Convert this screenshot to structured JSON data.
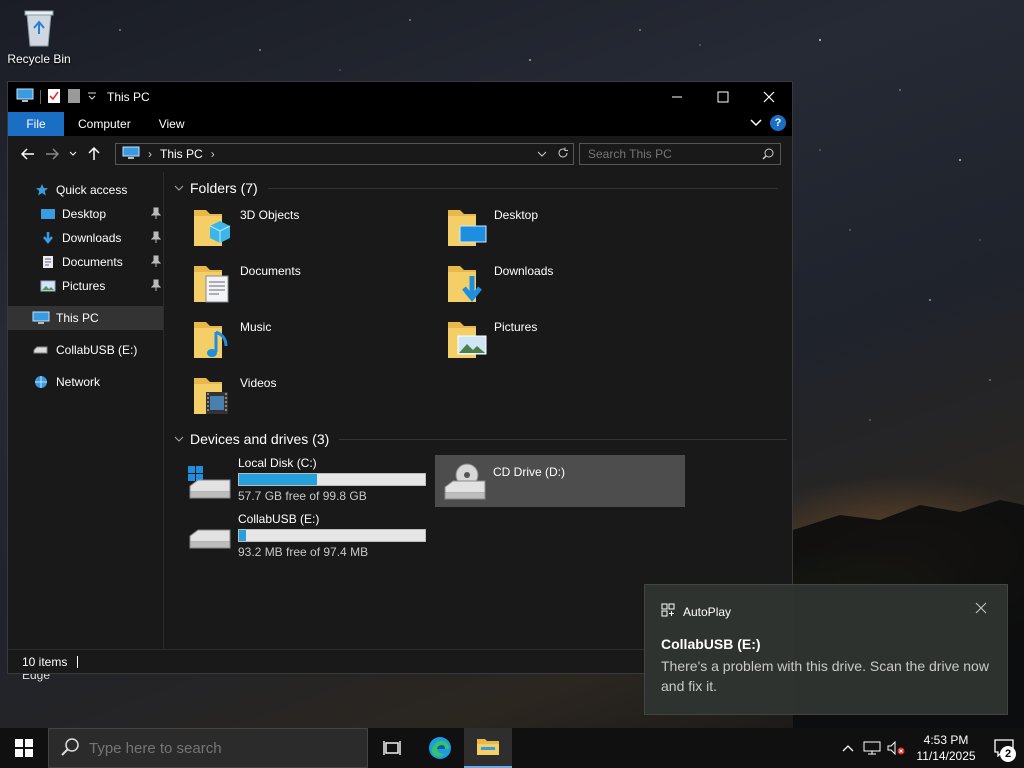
{
  "desktop": {
    "recycle_bin_label": "Recycle Bin",
    "edge_label": "Edge"
  },
  "window": {
    "title": "This PC",
    "ribbon_tabs": [
      "File",
      "Computer",
      "View"
    ],
    "help_label": "?",
    "address": {
      "crumb": "This PC"
    },
    "search_placeholder": "Search This PC",
    "status": {
      "item_count": "10 items"
    }
  },
  "nav_pane": {
    "quick_access": "Quick access",
    "quick_items": [
      "Desktop",
      "Downloads",
      "Documents",
      "Pictures"
    ],
    "this_pc": "This PC",
    "usb": "CollabUSB (E:)",
    "network": "Network"
  },
  "content": {
    "folders_header": "Folders (7)",
    "folders": [
      "3D Objects",
      "Desktop",
      "Documents",
      "Downloads",
      "Music",
      "Pictures",
      "Videos"
    ],
    "drives_header": "Devices and drives (3)",
    "drives": [
      {
        "name": "Local Disk (C:)",
        "free": "57.7 GB free of 99.8 GB",
        "used_fraction": 0.42
      },
      {
        "name": "CD Drive (D:)"
      },
      {
        "name": "CollabUSB (E:)",
        "free": "93.2 MB free of 97.4 MB",
        "used_fraction": 0.04
      }
    ]
  },
  "toast": {
    "app": "AutoPlay",
    "title": "CollabUSB (E:)",
    "body": "There's a problem with this drive.  Scan the drive now and fix it."
  },
  "taskbar": {
    "search_placeholder": "Type here to search",
    "time": "4:53 PM",
    "date": "11/14/2025",
    "notification_count": "2"
  },
  "colors": {
    "accent": "#1a6fc4",
    "progress": "#26a0da",
    "folder": "#e8b84a"
  }
}
